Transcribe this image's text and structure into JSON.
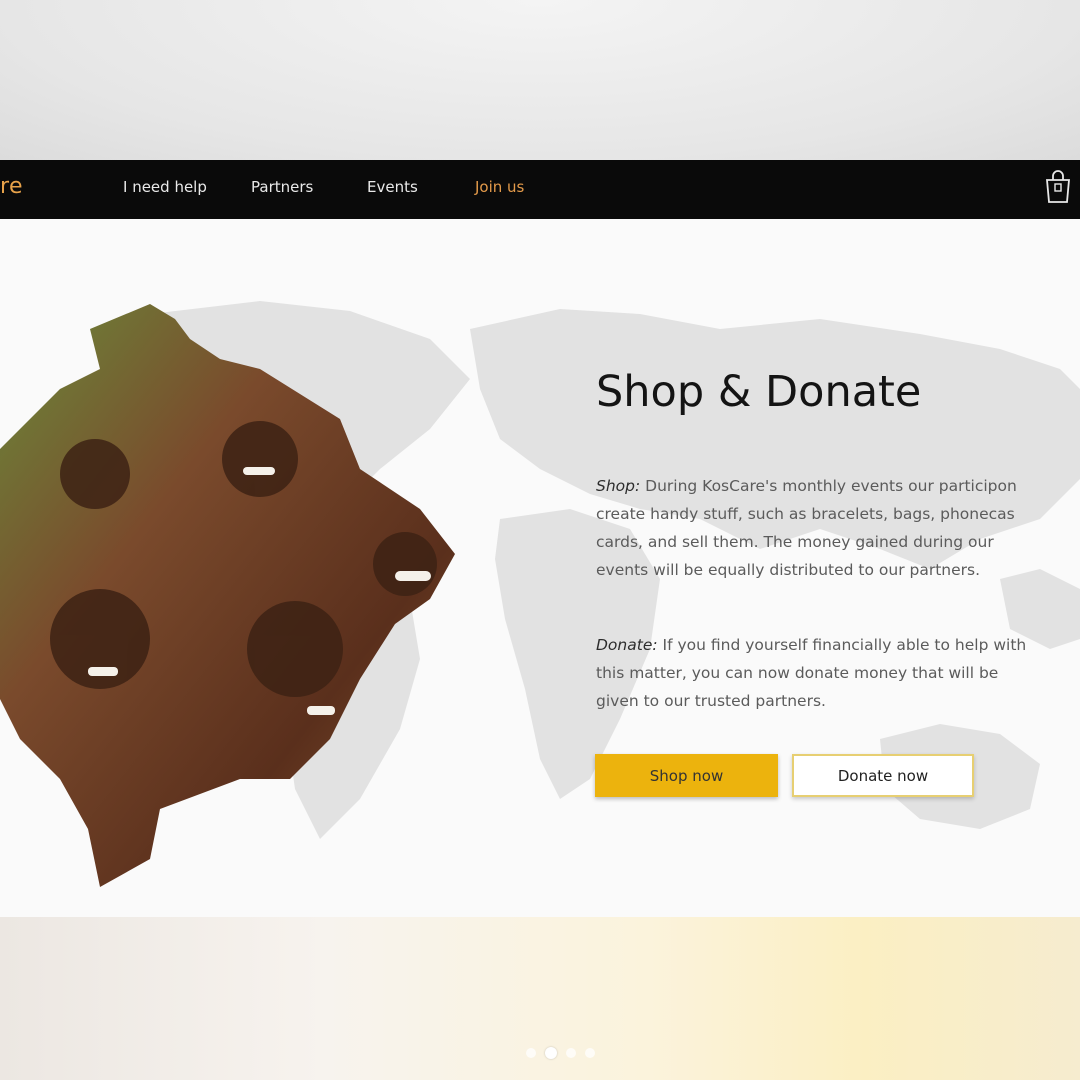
{
  "header": {
    "logo_text": "re",
    "nav": [
      {
        "label": "I need help"
      },
      {
        "label": "Partners"
      },
      {
        "label": "Events"
      },
      {
        "label": "Join us"
      }
    ],
    "cart_icon": "shopping-bag-icon"
  },
  "hero": {
    "title": "Shop & Donate",
    "shop_label": "Shop:",
    "shop_text": " During KosCare's monthly events our participon\ncreate handy stuff, such as bracelets, bags, phonecas\ncards, and sell them. The money gained during our\nevents will be equally distributed to our partners.",
    "donate_label": "Donate:",
    "donate_text": " If you find yourself financially able to help with\nthis matter, you can now donate money that will be\ngiven to our trusted partners.",
    "shop_button": "Shop now",
    "donate_button": "Donate now"
  },
  "carousel": {
    "count": 4,
    "active_index": 1
  },
  "colors": {
    "accent_orange": "#e39a4a",
    "button_yellow": "#ecb30d",
    "navbar_bg": "#0a0a0a"
  }
}
